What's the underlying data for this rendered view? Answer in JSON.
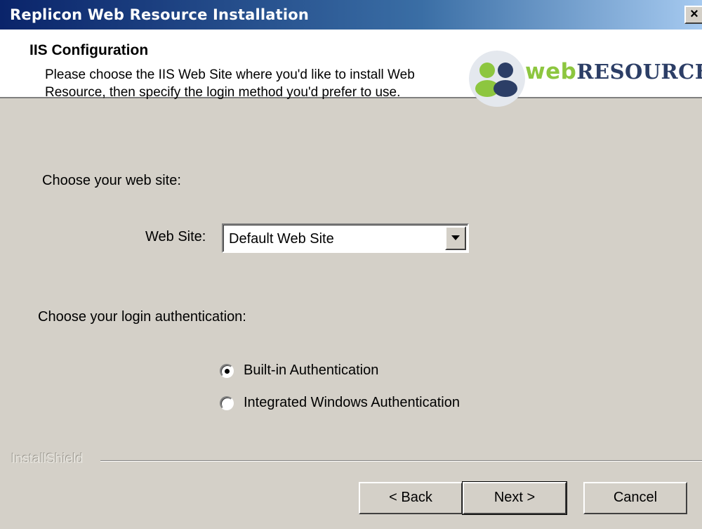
{
  "window": {
    "title": "Replicon Web Resource Installation",
    "close_glyph": "×",
    "close_icon": "close-icon"
  },
  "header": {
    "title": "IIS Configuration",
    "description_line1": "Please choose the IIS Web Site where you'd like to install Web",
    "description_line2": "Resource, then specify the login method you'd prefer to use.",
    "logo_web": "web",
    "logo_resource": "RESOURCE",
    "logo_icon": "users-icon",
    "colors": {
      "logo_green": "#8dc63f",
      "logo_navy": "#2c3e66"
    }
  },
  "site_section": {
    "prompt": "Choose your web site:",
    "field_label": "Web Site:",
    "selected_value": "Default Web Site",
    "dropdown_icon": "chevron-down-icon"
  },
  "auth_section": {
    "prompt": "Choose your login authentication:",
    "options": [
      {
        "label": "Built-in Authentication",
        "checked": true
      },
      {
        "label": "Integrated Windows Authentication",
        "checked": false
      }
    ]
  },
  "footer": {
    "brand": "InstallShield",
    "back_label": "< Back",
    "next_label": "Next >",
    "cancel_label": "Cancel"
  },
  "colors": {
    "titlebar_start": "#0a246a",
    "titlebar_end": "#a6caf0",
    "dialog_face": "#d4d0c8"
  }
}
